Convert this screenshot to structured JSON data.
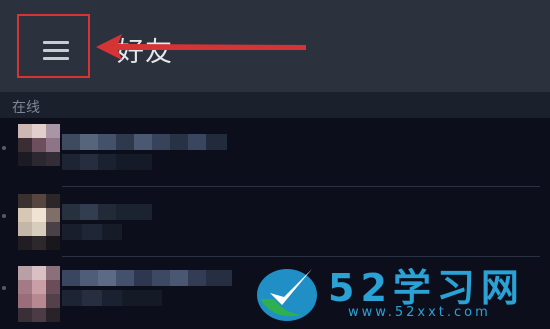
{
  "header": {
    "title": "好友",
    "menu_icon": "hamburger-menu-icon",
    "highlight_color": "#d63434"
  },
  "sections": [
    {
      "label": "在线"
    }
  ],
  "friends": [
    {
      "name": "",
      "status": "online"
    },
    {
      "name": "",
      "status": "online"
    },
    {
      "name": "",
      "status": "online"
    }
  ],
  "watermark": {
    "text": "52学习网",
    "url": "www.52xxt.com"
  }
}
